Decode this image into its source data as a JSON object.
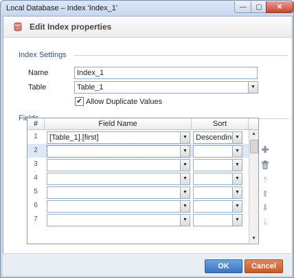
{
  "window": {
    "title": "Local Database – Index 'Index_1'",
    "min_glyph": "—",
    "max_glyph": "▢",
    "close_glyph": "✕"
  },
  "header": {
    "title": "Edit Index properties"
  },
  "index_settings": {
    "section_label": "Index Settings",
    "name_label": "Name",
    "name_value": "Index_1",
    "table_label": "Table",
    "table_value": "Table_1",
    "allow_duplicates_label": "Allow Duplicate Values",
    "allow_duplicates_checked": true,
    "check_glyph": "✔"
  },
  "fields": {
    "section_label": "Fields",
    "columns": {
      "num": "#",
      "field_name": "Field Name",
      "sort": "Sort"
    },
    "rows": [
      {
        "num": "1",
        "field": "[Table_1].[first]",
        "sort": "Descending"
      },
      {
        "num": "2",
        "field": "",
        "sort": ""
      },
      {
        "num": "3",
        "field": "",
        "sort": ""
      },
      {
        "num": "4",
        "field": "",
        "sort": ""
      },
      {
        "num": "5",
        "field": "",
        "sort": ""
      },
      {
        "num": "6",
        "field": "",
        "sort": ""
      },
      {
        "num": "7",
        "field": "",
        "sort": ""
      }
    ],
    "selected_row": 2
  },
  "icons": {
    "add": "plus-icon",
    "delete": "trash-icon",
    "move_top": "move-top-icon",
    "move_up": "arrow-up-icon",
    "move_down": "arrow-down-icon",
    "move_bottom": "move-bottom-icon"
  },
  "footer": {
    "ok_label": "OK",
    "cancel_label": "Cancel"
  },
  "colors": {
    "ok": "#3a74c2",
    "cancel": "#c45a28",
    "selection": "#dce8f8"
  }
}
